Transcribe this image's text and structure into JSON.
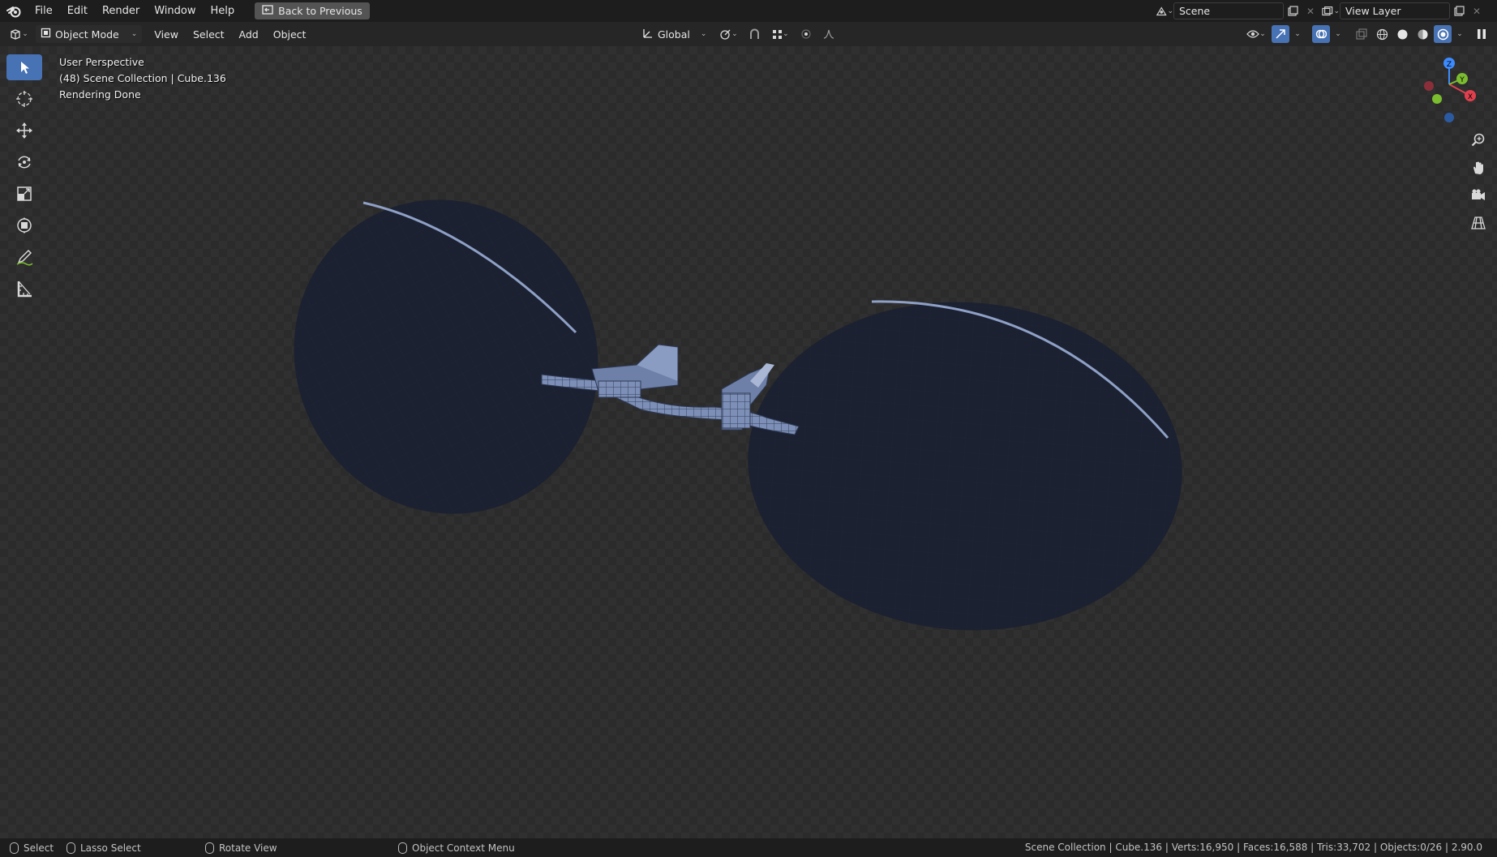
{
  "menubar": {
    "items": [
      "File",
      "Edit",
      "Render",
      "Window",
      "Help"
    ],
    "back_button": "Back to Previous",
    "scene_label": "Scene",
    "view_layer_label": "View Layer"
  },
  "header": {
    "mode": "Object Mode",
    "menus": [
      "View",
      "Select",
      "Add",
      "Object"
    ],
    "transform_orientation": "Global"
  },
  "viewport": {
    "overlay": {
      "perspective": "User Perspective",
      "collection": "(48) Scene Collection | Cube.136",
      "status": "Rendering Done"
    },
    "gizmo_axes": {
      "x": "X",
      "y": "Y",
      "z": "Z"
    }
  },
  "toolbar": {
    "tools": [
      "select-box",
      "cursor",
      "move",
      "rotate",
      "scale",
      "transform",
      "annotate",
      "measure"
    ]
  },
  "statusbar": {
    "select": "Select",
    "lasso": "Lasso Select",
    "rotate": "Rotate View",
    "context": "Object Context Menu",
    "stats": "Scene Collection | Cube.136 | Verts:16,950 | Faces:16,588 | Tris:33,702 | Objects:0/26 | 2.90.0"
  },
  "colors": {
    "accent": "#4772b3",
    "axis_x": "#e0404e",
    "axis_y": "#7bbd2f",
    "axis_z": "#3d8bff",
    "lens": "#1b2130",
    "frame": "#6f82a8"
  }
}
